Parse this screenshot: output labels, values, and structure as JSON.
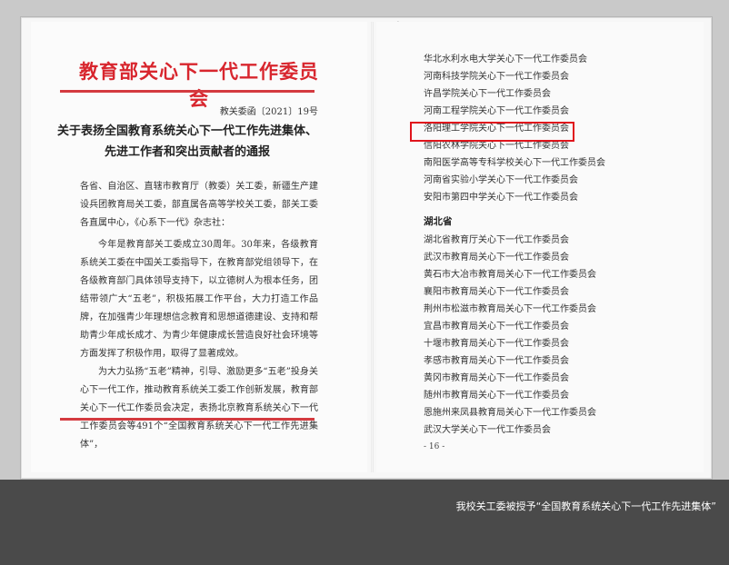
{
  "document": {
    "header": "教育部关心下一代工作委员会",
    "doc_number": "教关委函〔2021〕19号",
    "title_line1": "关于表扬全国教育系统关心下一代工作先进集体、",
    "title_line2": "先进工作者和突出贡献者的通报",
    "recipients": "各省、自治区、直辖市教育厅（教委）关工委，新疆生产建设兵团教育局关工委，部直属各高等学校关工委，部关工委各直属中心，《心系下一代》杂志社：",
    "para1": "今年是教育部关工委成立30周年。30年来，各级教育系统关工委在中国关工委指导下，在教育部党组领导下，在各级教育部门具体领导支持下，以立德树人为根本任务，团结带领广大“五老”，积极拓展工作平台，大力打造工作品牌，在加强青少年理想信念教育和思想道德建设、支持和帮助青少年成长成才、为青少年健康成长营造良好社会环境等方面发挥了积极作用，取得了显著成效。",
    "para2": "为大力弘扬“五老”精神，引导、激励更多“五老”投身关心下一代工作，推动教育系统关工委工作创新发展，教育部关心下一代工作委员会决定，表扬北京教育系统关心下一代工作委员会等491个“全国教育系统关心下一代工作先进集体”，"
  },
  "list": {
    "henan_items": [
      "华北水利水电大学关心下一代工作委员会",
      "河南科技学院关心下一代工作委员会",
      "许昌学院关心下一代工作委员会",
      "河南工程学院关心下一代工作委员会",
      "洛阳理工学院关心下一代工作委员会",
      "信阳农林学院关心下一代工作委员会",
      "南阳医学高等专科学校关心下一代工作委员会",
      "河南省实验小学关心下一代工作委员会",
      "安阳市第四中学关心下一代工作委员会"
    ],
    "hubei_heading": "湖北省",
    "hubei_items": [
      "湖北省教育厅关心下一代工作委员会",
      "武汉市教育局关心下一代工作委员会",
      "黄石市大冶市教育局关心下一代工作委员会",
      "襄阳市教育局关心下一代工作委员会",
      "荆州市松滋市教育局关心下一代工作委员会",
      "宜昌市教育局关心下一代工作委员会",
      "十堰市教育局关心下一代工作委员会",
      "孝感市教育局关心下一代工作委员会",
      "黄冈市教育局关心下一代工作委员会",
      "随州市教育局关心下一代工作委员会",
      "恩施州来凤县教育局关心下一代工作委员会",
      "武汉大学关心下一代工作委员会"
    ],
    "page_number": "- 16 -"
  },
  "caption": "我校关工委被授予“全国教育系统关心下一代工作先进集体”",
  "colors": {
    "header_red": "#d8262e",
    "highlight_red": "#e0141c",
    "background": "#4a4a4a"
  }
}
